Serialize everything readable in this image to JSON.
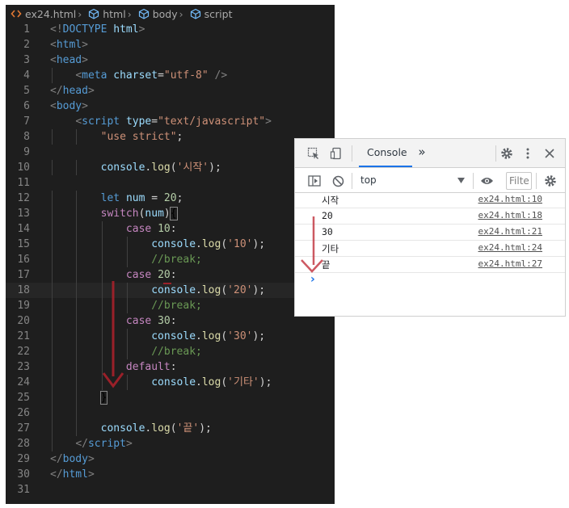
{
  "editor": {
    "breadcrumbs": [
      "ex24.html",
      "html",
      "body",
      "script"
    ],
    "lines": [
      {
        "n": "1",
        "t": [
          [
            "punct",
            "<!"
          ],
          [
            "tag",
            "DOCTYPE"
          ],
          [
            "plain",
            " "
          ],
          [
            "attr",
            "html"
          ],
          [
            "punct",
            ">"
          ]
        ]
      },
      {
        "n": "2",
        "t": [
          [
            "punct",
            "<"
          ],
          [
            "tag",
            "html"
          ],
          [
            "punct",
            ">"
          ]
        ]
      },
      {
        "n": "3",
        "t": [
          [
            "punct",
            "<"
          ],
          [
            "tag",
            "head"
          ],
          [
            "punct",
            ">"
          ]
        ]
      },
      {
        "n": "4",
        "t": [
          [
            "plain",
            "    "
          ],
          [
            "punct",
            "<"
          ],
          [
            "tag",
            "meta"
          ],
          [
            "plain",
            " "
          ],
          [
            "attr",
            "charset"
          ],
          [
            "plain",
            "="
          ],
          [
            "str",
            "\"utf-8\""
          ],
          [
            "plain",
            " "
          ],
          [
            "punct",
            "/>"
          ]
        ]
      },
      {
        "n": "5",
        "t": [
          [
            "punct",
            "</"
          ],
          [
            "tag",
            "head"
          ],
          [
            "punct",
            ">"
          ]
        ]
      },
      {
        "n": "6",
        "t": [
          [
            "punct",
            "<"
          ],
          [
            "tag",
            "body"
          ],
          [
            "punct",
            ">"
          ]
        ]
      },
      {
        "n": "7",
        "t": [
          [
            "plain",
            "    "
          ],
          [
            "punct",
            "<"
          ],
          [
            "tag",
            "script"
          ],
          [
            "plain",
            " "
          ],
          [
            "attr",
            "type"
          ],
          [
            "plain",
            "="
          ],
          [
            "str",
            "\"text/javascript\""
          ],
          [
            "punct",
            ">"
          ]
        ]
      },
      {
        "n": "8",
        "t": [
          [
            "plain",
            "        "
          ],
          [
            "str",
            "\"use strict\""
          ],
          [
            "plain",
            ";"
          ]
        ]
      },
      {
        "n": "9",
        "t": []
      },
      {
        "n": "10",
        "t": [
          [
            "plain",
            "        "
          ],
          [
            "var",
            "console"
          ],
          [
            "plain",
            "."
          ],
          [
            "fn",
            "log"
          ],
          [
            "plain",
            "("
          ],
          [
            "str",
            "'시작'"
          ],
          [
            "plain",
            ");"
          ]
        ]
      },
      {
        "n": "11",
        "t": []
      },
      {
        "n": "12",
        "t": [
          [
            "plain",
            "        "
          ],
          [
            "decl",
            "let"
          ],
          [
            "plain",
            " "
          ],
          [
            "var",
            "num"
          ],
          [
            "plain",
            " = "
          ],
          [
            "num",
            "20"
          ],
          [
            "plain",
            ";"
          ]
        ]
      },
      {
        "n": "13",
        "t": [
          [
            "plain",
            "        "
          ],
          [
            "kw",
            "switch"
          ],
          [
            "plain",
            "("
          ],
          [
            "var",
            "num"
          ],
          [
            "plain",
            ")"
          ],
          [
            "brk",
            "{"
          ]
        ]
      },
      {
        "n": "14",
        "t": [
          [
            "plain",
            "            "
          ],
          [
            "kw",
            "case"
          ],
          [
            "plain",
            " "
          ],
          [
            "num",
            "10"
          ],
          [
            "plain",
            ":"
          ]
        ]
      },
      {
        "n": "15",
        "t": [
          [
            "plain",
            "                "
          ],
          [
            "var",
            "console"
          ],
          [
            "plain",
            "."
          ],
          [
            "fn",
            "log"
          ],
          [
            "plain",
            "("
          ],
          [
            "str",
            "'10'"
          ],
          [
            "plain",
            ");"
          ]
        ]
      },
      {
        "n": "16",
        "t": [
          [
            "plain",
            "                "
          ],
          [
            "cmt",
            "//break;"
          ]
        ]
      },
      {
        "n": "17",
        "t": [
          [
            "plain",
            "            "
          ],
          [
            "kw",
            "case"
          ],
          [
            "plain",
            " "
          ],
          [
            "num",
            "20"
          ],
          [
            "plain",
            ":"
          ]
        ]
      },
      {
        "n": "18",
        "t": [
          [
            "plain",
            "                "
          ],
          [
            "var",
            "console"
          ],
          [
            "plain",
            "."
          ],
          [
            "fn",
            "log"
          ],
          [
            "plain",
            "("
          ],
          [
            "str",
            "'20'"
          ],
          [
            "plain",
            ");"
          ]
        ]
      },
      {
        "n": "19",
        "t": [
          [
            "plain",
            "                "
          ],
          [
            "cmt",
            "//break;"
          ]
        ]
      },
      {
        "n": "20",
        "t": [
          [
            "plain",
            "            "
          ],
          [
            "kw",
            "case"
          ],
          [
            "plain",
            " "
          ],
          [
            "num",
            "30"
          ],
          [
            "plain",
            ":"
          ]
        ]
      },
      {
        "n": "21",
        "t": [
          [
            "plain",
            "                "
          ],
          [
            "var",
            "console"
          ],
          [
            "plain",
            "."
          ],
          [
            "fn",
            "log"
          ],
          [
            "plain",
            "("
          ],
          [
            "str",
            "'30'"
          ],
          [
            "plain",
            ");"
          ]
        ]
      },
      {
        "n": "22",
        "t": [
          [
            "plain",
            "                "
          ],
          [
            "cmt",
            "//break;"
          ]
        ]
      },
      {
        "n": "23",
        "t": [
          [
            "plain",
            "            "
          ],
          [
            "kw",
            "default"
          ],
          [
            "plain",
            ":"
          ]
        ]
      },
      {
        "n": "24",
        "t": [
          [
            "plain",
            "                "
          ],
          [
            "var",
            "console"
          ],
          [
            "plain",
            "."
          ],
          [
            "fn",
            "log"
          ],
          [
            "plain",
            "("
          ],
          [
            "str",
            "'기타'"
          ],
          [
            "plain",
            ");"
          ]
        ]
      },
      {
        "n": "25",
        "t": [
          [
            "plain",
            "        "
          ],
          [
            "brk",
            "}"
          ]
        ]
      },
      {
        "n": "26",
        "t": []
      },
      {
        "n": "27",
        "t": [
          [
            "plain",
            "        "
          ],
          [
            "var",
            "console"
          ],
          [
            "plain",
            "."
          ],
          [
            "fn",
            "log"
          ],
          [
            "plain",
            "("
          ],
          [
            "str",
            "'끝'"
          ],
          [
            "plain",
            ");"
          ]
        ]
      },
      {
        "n": "28",
        "t": [
          [
            "plain",
            "    "
          ],
          [
            "punct",
            "</"
          ],
          [
            "tag",
            "script"
          ],
          [
            "punct",
            ">"
          ]
        ]
      },
      {
        "n": "29",
        "t": [
          [
            "punct",
            "</"
          ],
          [
            "tag",
            "body"
          ],
          [
            "punct",
            ">"
          ]
        ]
      },
      {
        "n": "30",
        "t": [
          [
            "punct",
            "</"
          ],
          [
            "tag",
            "html"
          ],
          [
            "punct",
            ">"
          ]
        ]
      },
      {
        "n": "31",
        "t": []
      }
    ],
    "current_line": "18"
  },
  "devtools": {
    "tab_console": "Console",
    "more_tabs": "»",
    "context_select": "top",
    "filter_placeholder": "Filte",
    "messages": [
      {
        "text": "시작",
        "source": "ex24.html:10"
      },
      {
        "text": "20",
        "source": "ex24.html:18"
      },
      {
        "text": "30",
        "source": "ex24.html:21"
      },
      {
        "text": "기타",
        "source": "ex24.html:24"
      },
      {
        "text": "끝",
        "source": "ex24.html:27"
      }
    ],
    "prompt": "›"
  },
  "colors": {
    "annotation_arrow": "#b0212b",
    "prompt_arrow": "#1a73e8"
  }
}
